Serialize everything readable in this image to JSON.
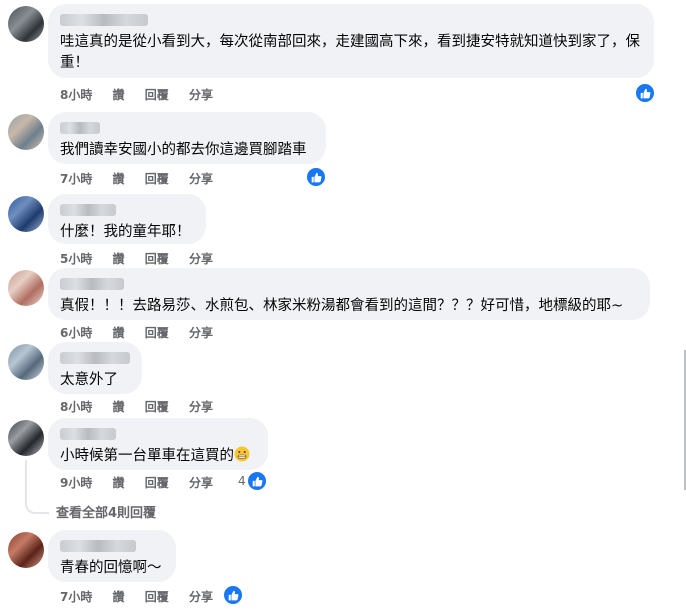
{
  "actions": {
    "like": "讚",
    "reply": "回覆",
    "share": "分享"
  },
  "comments": [
    {
      "time": "8小時",
      "text": "哇這真的是從小看到大，每次從南部回來，走建國高下來，看到捷安特就知道快到家了，保重！",
      "likes": ""
    },
    {
      "time": "7小時",
      "text": "我們讀幸安國小的都去你這邊買腳踏車",
      "likes": ""
    },
    {
      "time": "5小時",
      "text": "什麼！我的童年耶！",
      "likes": ""
    },
    {
      "time": "6小時",
      "text": "真假！！！去路易莎、水煎包、林家米粉湯都會看到的這間？？？好可惜，地標級的耶~",
      "likes": ""
    },
    {
      "time": "8小時",
      "text": "太意外了",
      "likes": ""
    },
    {
      "time": "9小時",
      "text": "小時候第一台單車在這買的",
      "likes": "4"
    },
    {
      "time": "7小時",
      "text": "青春的回憶啊～",
      "likes": ""
    }
  ],
  "view_replies": "查看全部4則回覆",
  "colors": {
    "like_blue": "#1877f2",
    "bubble_bg": "#f0f2f5",
    "meta_gray": "#65676b"
  }
}
